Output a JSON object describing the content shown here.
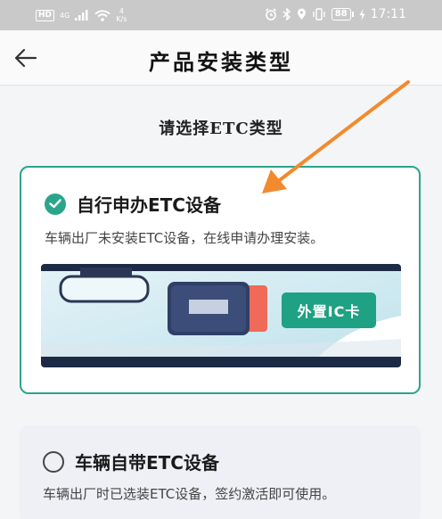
{
  "status_bar": {
    "hd": "HD",
    "network": "4G",
    "speed_value": "4",
    "speed_unit": "K/s",
    "battery": "88",
    "time": "17:11"
  },
  "nav": {
    "title": "产品安装类型"
  },
  "prompt": "请选择ETC类型",
  "options": [
    {
      "label": "自行申办ETC设备",
      "description": "车辆出厂未安装ETC设备，在线申请办理安装。",
      "selected": true,
      "illustration_tag": "外置IC卡"
    },
    {
      "label": "车辆自带ETC设备",
      "description": "车辆出厂时已选装ETC设备，签约激活即可使用。",
      "selected": false
    }
  ],
  "colors": {
    "accent": "#2aa58b",
    "annotation_arrow": "#f28a2e"
  }
}
